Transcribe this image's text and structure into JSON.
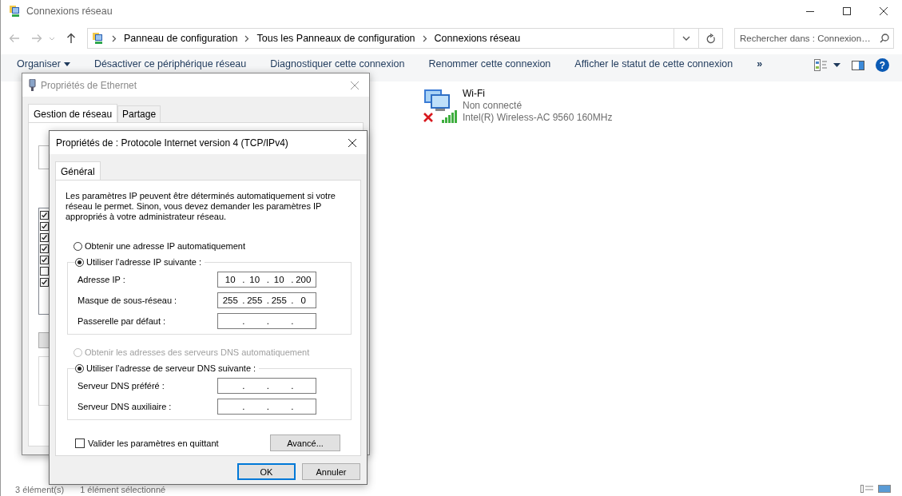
{
  "window": {
    "title": "Connexions réseau"
  },
  "address_bar": {
    "breadcrumbs": [
      "Panneau de configuration",
      "Tous les Panneaux de configuration",
      "Connexions réseau"
    ]
  },
  "search": {
    "placeholder": "Rechercher dans : Connexion…"
  },
  "toolbar": {
    "items": [
      {
        "label": "Organiser",
        "kind": "menu"
      },
      {
        "label": "Désactiver ce périphérique réseau",
        "kind": "command"
      },
      {
        "label": "Diagnostiquer cette connexion",
        "kind": "command"
      },
      {
        "label": "Renommer cette connexion",
        "kind": "command"
      },
      {
        "label": "Afficher le statut de cette connexion",
        "kind": "command"
      },
      {
        "label": "»",
        "kind": "overflow"
      }
    ],
    "help": "?"
  },
  "connections": [
    {
      "name": "Wi-Fi",
      "status": "Non connecté",
      "device": "Intel(R) Wireless-AC 9560 160MHz",
      "connected": false
    }
  ],
  "status_bar": {
    "items": [
      "3 élément(s)",
      "1 élément sélectionné"
    ]
  },
  "ethernet_dialog": {
    "title": "Propriétés de Ethernet",
    "active": false,
    "tabs": [
      {
        "label": "Gestion de réseau",
        "selected": true
      },
      {
        "label": "Partage",
        "selected": false
      }
    ],
    "components": [
      {
        "checked": true
      },
      {
        "checked": true
      },
      {
        "checked": true
      },
      {
        "checked": true
      },
      {
        "checked": true
      },
      {
        "checked": false
      },
      {
        "checked": true
      }
    ]
  },
  "ipv4_dialog": {
    "title": "Propriétés de : Protocole Internet version 4 (TCP/IPv4)",
    "active": true,
    "tabs": [
      {
        "label": "Général",
        "selected": true
      }
    ],
    "description": "Les paramètres IP peuvent être déterminés automatiquement si votre réseau le permet. Sinon, vous devez demander les paramètres IP appropriés à votre administrateur réseau.",
    "separator": ".",
    "options": [
      {
        "kind": "radio",
        "label": "Obtenir une adresse IP automatiquement",
        "selected": false,
        "disabled": false
      },
      {
        "kind": "group",
        "label": "Utiliser l’adresse IP suivante :",
        "selected": true,
        "disabled": false,
        "fields": [
          {
            "label": "Adresse IP :",
            "octets": [
              "10",
              "10",
              "10",
              "200"
            ]
          },
          {
            "label": "Masque de sous-réseau :",
            "octets": [
              "255",
              "255",
              "255",
              "0"
            ]
          },
          {
            "label": "Passerelle par défaut :"
          }
        ]
      },
      {
        "kind": "radio",
        "label": "Obtenir les adresses des serveurs DNS automatiquement",
        "selected": false,
        "disabled": true
      },
      {
        "kind": "group",
        "label": "Utiliser l’adresse de serveur DNS suivante :",
        "selected": true,
        "disabled": false,
        "fields": [
          {
            "label": "Serveur DNS préféré :"
          },
          {
            "label": "Serveur DNS auxiliaire :"
          }
        ]
      }
    ],
    "validate": {
      "label": "Valider les paramètres en quittant",
      "checked": false
    },
    "advanced_button": "Avancé...",
    "buttons": [
      {
        "label": "OK",
        "default": true
      },
      {
        "label": "Annuler",
        "default": false
      }
    ]
  }
}
